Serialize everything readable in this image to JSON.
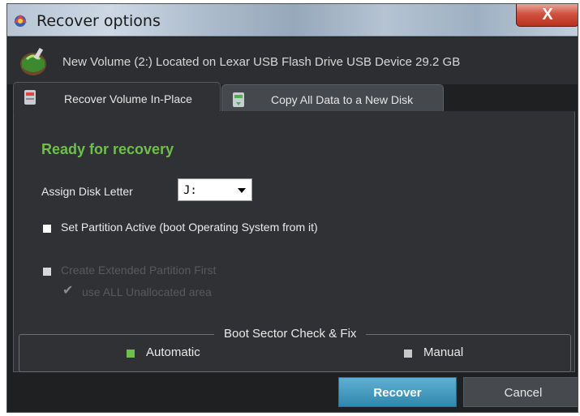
{
  "window": {
    "title": "Recover options",
    "close_label": "X"
  },
  "header": {
    "volume_info": "New Volume (2:) Located on Lexar USB Flash Drive USB Device 29.2 GB"
  },
  "tabs": [
    {
      "label": "Recover Volume In-Place",
      "active": true
    },
    {
      "label": "Copy All Data to a New Disk",
      "active": false
    }
  ],
  "panel": {
    "status": "Ready for recovery",
    "assign_disk_letter_label": "Assign Disk Letter",
    "disk_letter_value": "J:",
    "set_active_label": "Set Partition Active (boot Operating System from it)",
    "set_active_checked": false,
    "extended_partition_label": "Create Extended Partition First",
    "extended_partition_enabled": false,
    "use_all_label": "use ALL Unallocated area",
    "use_all_checked": true,
    "boot_sector_title": "Boot Sector Check & Fix",
    "boot_options": [
      {
        "label": "Automatic",
        "selected": true
      },
      {
        "label": "Manual",
        "selected": false
      }
    ]
  },
  "buttons": {
    "recover": "Recover",
    "cancel": "Cancel"
  },
  "colors": {
    "accent_green": "#6fc04a",
    "recover_button": "#3c97bd",
    "background": "#2f3134"
  }
}
